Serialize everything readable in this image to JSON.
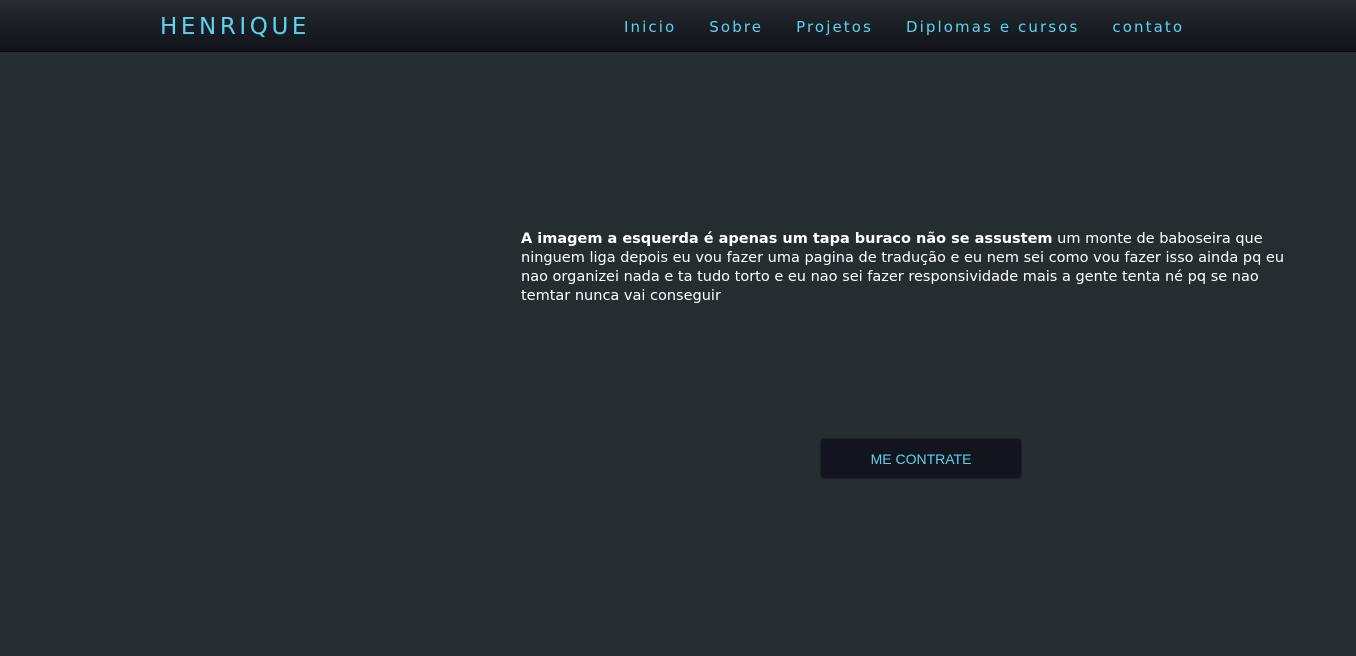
{
  "navbar": {
    "brand": "HENRIQUE",
    "links": [
      {
        "label": "Inicio"
      },
      {
        "label": "Sobre"
      },
      {
        "label": "Projetos"
      },
      {
        "label": "Diplomas e cursos"
      },
      {
        "label": "contato"
      }
    ]
  },
  "hero": {
    "bold_text": "A imagem a esquerda é apenas um tapa buraco não se assustem",
    "body_text": " um monte de baboseira que ninguem liga depois eu vou fazer uma pagina de tradução e eu nem sei como vou fazer isso ainda pq eu nao organizei nada e ta tudo torto e eu nao sei fazer responsividade mais a gente tenta né pq se nao temtar nunca vai conseguir",
    "button_label": "ME CONTRATE"
  },
  "colors": {
    "background": "#252d30",
    "accent": "#5fd3ee",
    "navbar": "#181c23",
    "button_bg": "#12151e"
  }
}
